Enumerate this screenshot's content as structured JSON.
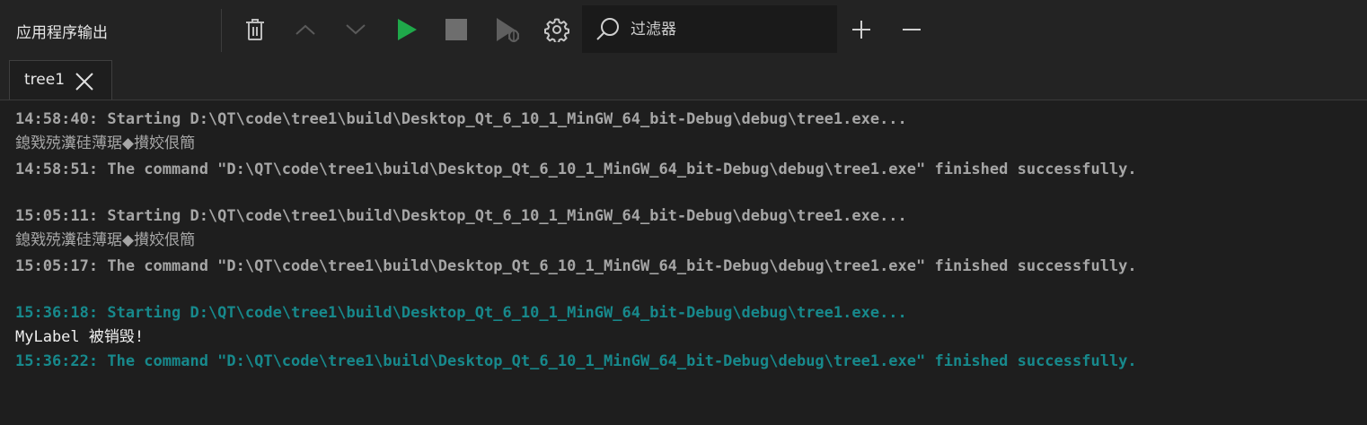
{
  "toolbar": {
    "panel_title": "应用程序输出",
    "filter_placeholder": "过滤器",
    "icons": {
      "clear": "trash-icon",
      "prev": "chevron-up-icon",
      "next": "chevron-down-icon",
      "run": "play-icon",
      "stop": "stop-icon",
      "attach_debugger": "debug-run-icon",
      "settings": "gear-icon",
      "search": "search-icon",
      "zoom_in": "plus-icon",
      "zoom_out": "minus-icon"
    },
    "colors": {
      "run": "#1fa84a",
      "stop": "#6e6e6e"
    }
  },
  "tabs": [
    {
      "label": "tree1",
      "active": true
    }
  ],
  "output": {
    "lines": [
      {
        "text": "14:58:40: Starting D:\\QT\\code\\tree1\\build\\Desktop_Qt_6_10_1_MinGW_64_bit-Debug\\debug\\tree1.exe...",
        "style": "gray-bold"
      },
      {
        "text": "鎴戣殑瀵硅薄琚◆攅姣佷簡",
        "style": "mojibake"
      },
      {
        "text": "14:58:51: The command \"D:\\QT\\code\\tree1\\build\\Desktop_Qt_6_10_1_MinGW_64_bit-Debug\\debug\\tree1.exe\" finished successfully.",
        "style": "gray-bold"
      },
      {
        "text": "15:05:11: Starting D:\\QT\\code\\tree1\\build\\Desktop_Qt_6_10_1_MinGW_64_bit-Debug\\debug\\tree1.exe...",
        "style": "gray-bold"
      },
      {
        "text": "鎴戣殑瀵硅薄琚◆攅姣佷簡",
        "style": "mojibake"
      },
      {
        "text": "15:05:17: The command \"D:\\QT\\code\\tree1\\build\\Desktop_Qt_6_10_1_MinGW_64_bit-Debug\\debug\\tree1.exe\" finished successfully.",
        "style": "gray-bold"
      },
      {
        "text": "15:36:18: Starting D:\\QT\\code\\tree1\\build\\Desktop_Qt_6_10_1_MinGW_64_bit-Debug\\debug\\tree1.exe...",
        "style": "teal-bold"
      },
      {
        "text": "MyLabel 被销毁!",
        "style": "white"
      },
      {
        "text": "15:36:22: The command \"D:\\QT\\code\\tree1\\build\\Desktop_Qt_6_10_1_MinGW_64_bit-Debug\\debug\\tree1.exe\" finished successfully.",
        "style": "teal-bold"
      }
    ],
    "colors": {
      "system": "#a6a6a6",
      "current_system": "#17898c",
      "stdout": "#f0f0f0"
    }
  }
}
